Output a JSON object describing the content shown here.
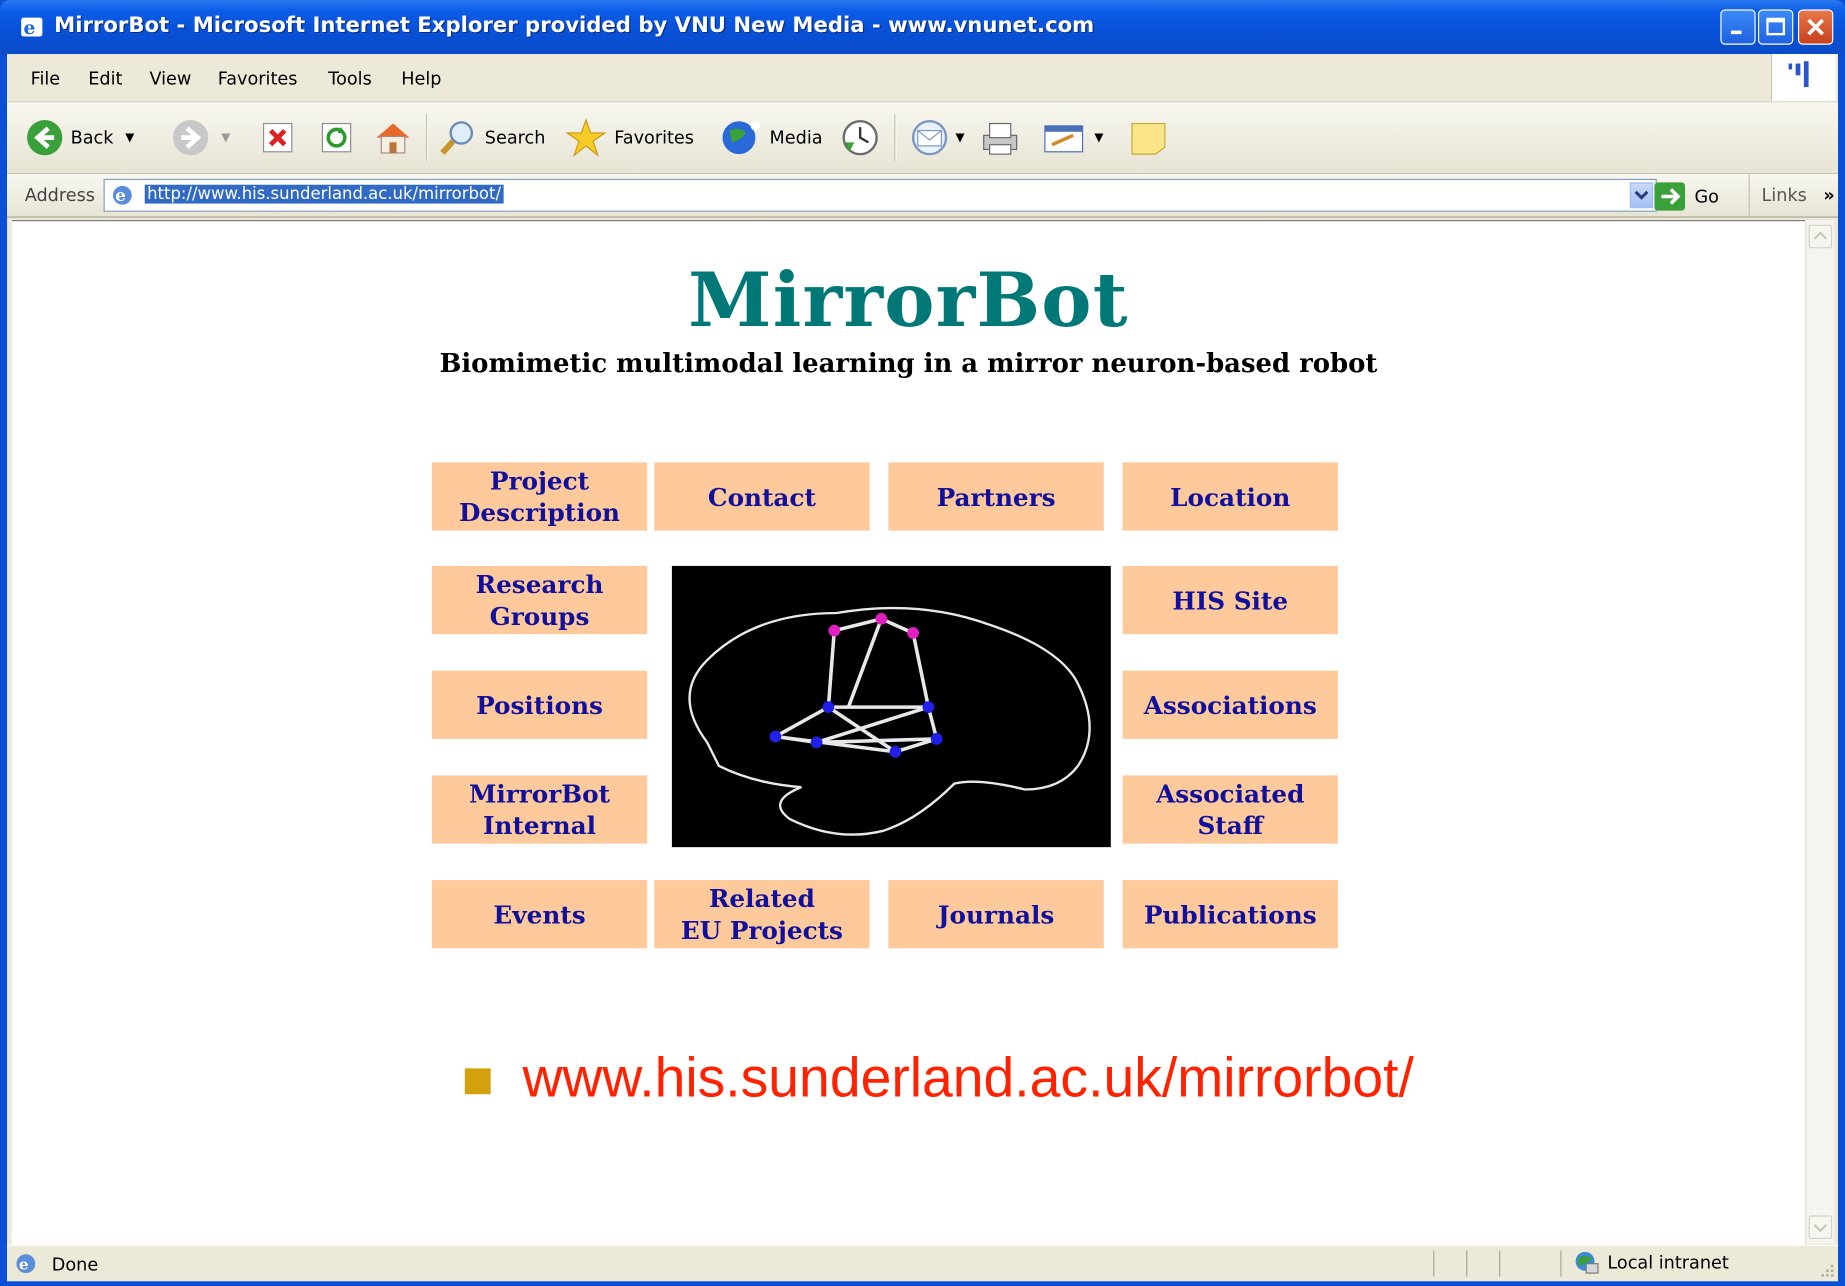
{
  "window": {
    "title": "MirrorBot - Microsoft Internet Explorer provided by VNU New Media - www.vnunet.com"
  },
  "menu": [
    "File",
    "Edit",
    "View",
    "Favorites",
    "Tools",
    "Help"
  ],
  "toolbar": {
    "back_label": "Back",
    "search_label": "Search",
    "favorites_label": "Favorites",
    "media_label": "Media"
  },
  "address": {
    "label": "Address",
    "url": "http://www.his.sunderland.ac.uk/mirrorbot/",
    "go_label": "Go",
    "links_label": "Links"
  },
  "page": {
    "title": "MirrorBot",
    "subtitle": "Biomimetic multimodal learning in a mirror neuron-based robot",
    "nav": {
      "project_description": "Project\nDescription",
      "contact": "Contact",
      "partners": "Partners",
      "location": "Location",
      "research_groups": "Research\nGroups",
      "his_site": "HIS Site",
      "positions": "Positions",
      "associations": "Associations",
      "mirrorbot_internal": "MirrorBot\nInternal",
      "associated_staff": "Associated\nStaff",
      "events": "Events",
      "related_eu_projects": "Related\nEU Projects",
      "journals": "Journals",
      "publications": "Publications"
    }
  },
  "slide": {
    "url_text": "www.his.sunderland.ac.uk/mirrorbot/"
  },
  "status": {
    "text": "Done",
    "zone": "Local intranet"
  },
  "colors": {
    "title_teal": "#007878",
    "nav_bg": "#fec99b",
    "nav_text": "#10109c",
    "url_red": "#ff2200",
    "bullet_gold": "#d2a10d"
  },
  "icons": [
    "ie-icon",
    "back-icon",
    "forward-icon",
    "stop-icon",
    "refresh-icon",
    "home-icon",
    "search-icon",
    "favorites-star-icon",
    "media-icon",
    "history-icon",
    "mail-icon",
    "print-icon",
    "edit-icon",
    "messenger-icon",
    "go-arrow-icon",
    "local-intranet-icon"
  ]
}
